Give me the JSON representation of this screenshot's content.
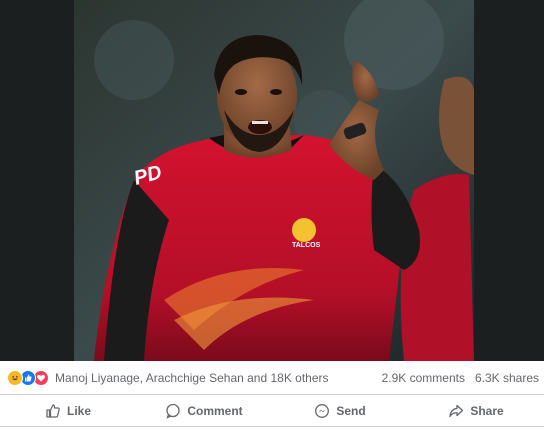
{
  "post": {
    "reactions": [
      "haha-icon",
      "like-icon",
      "love-icon"
    ],
    "reactors_text": "Manoj Liyanage, Arachchige Sehan and 18K others",
    "comments_count": "2.9K comments",
    "shares_count": "6.3K shares"
  },
  "actions": {
    "like": "Like",
    "comment": "Comment",
    "send": "Send",
    "share": "Share"
  },
  "jersey_text": "TALCOS",
  "sponsor_text": "PD",
  "colors": {
    "background": "#ffffff",
    "text_muted": "#65676b",
    "divider": "#ced0d4",
    "jersey_red": "#c8102e",
    "jersey_black": "#1a1a1a"
  }
}
